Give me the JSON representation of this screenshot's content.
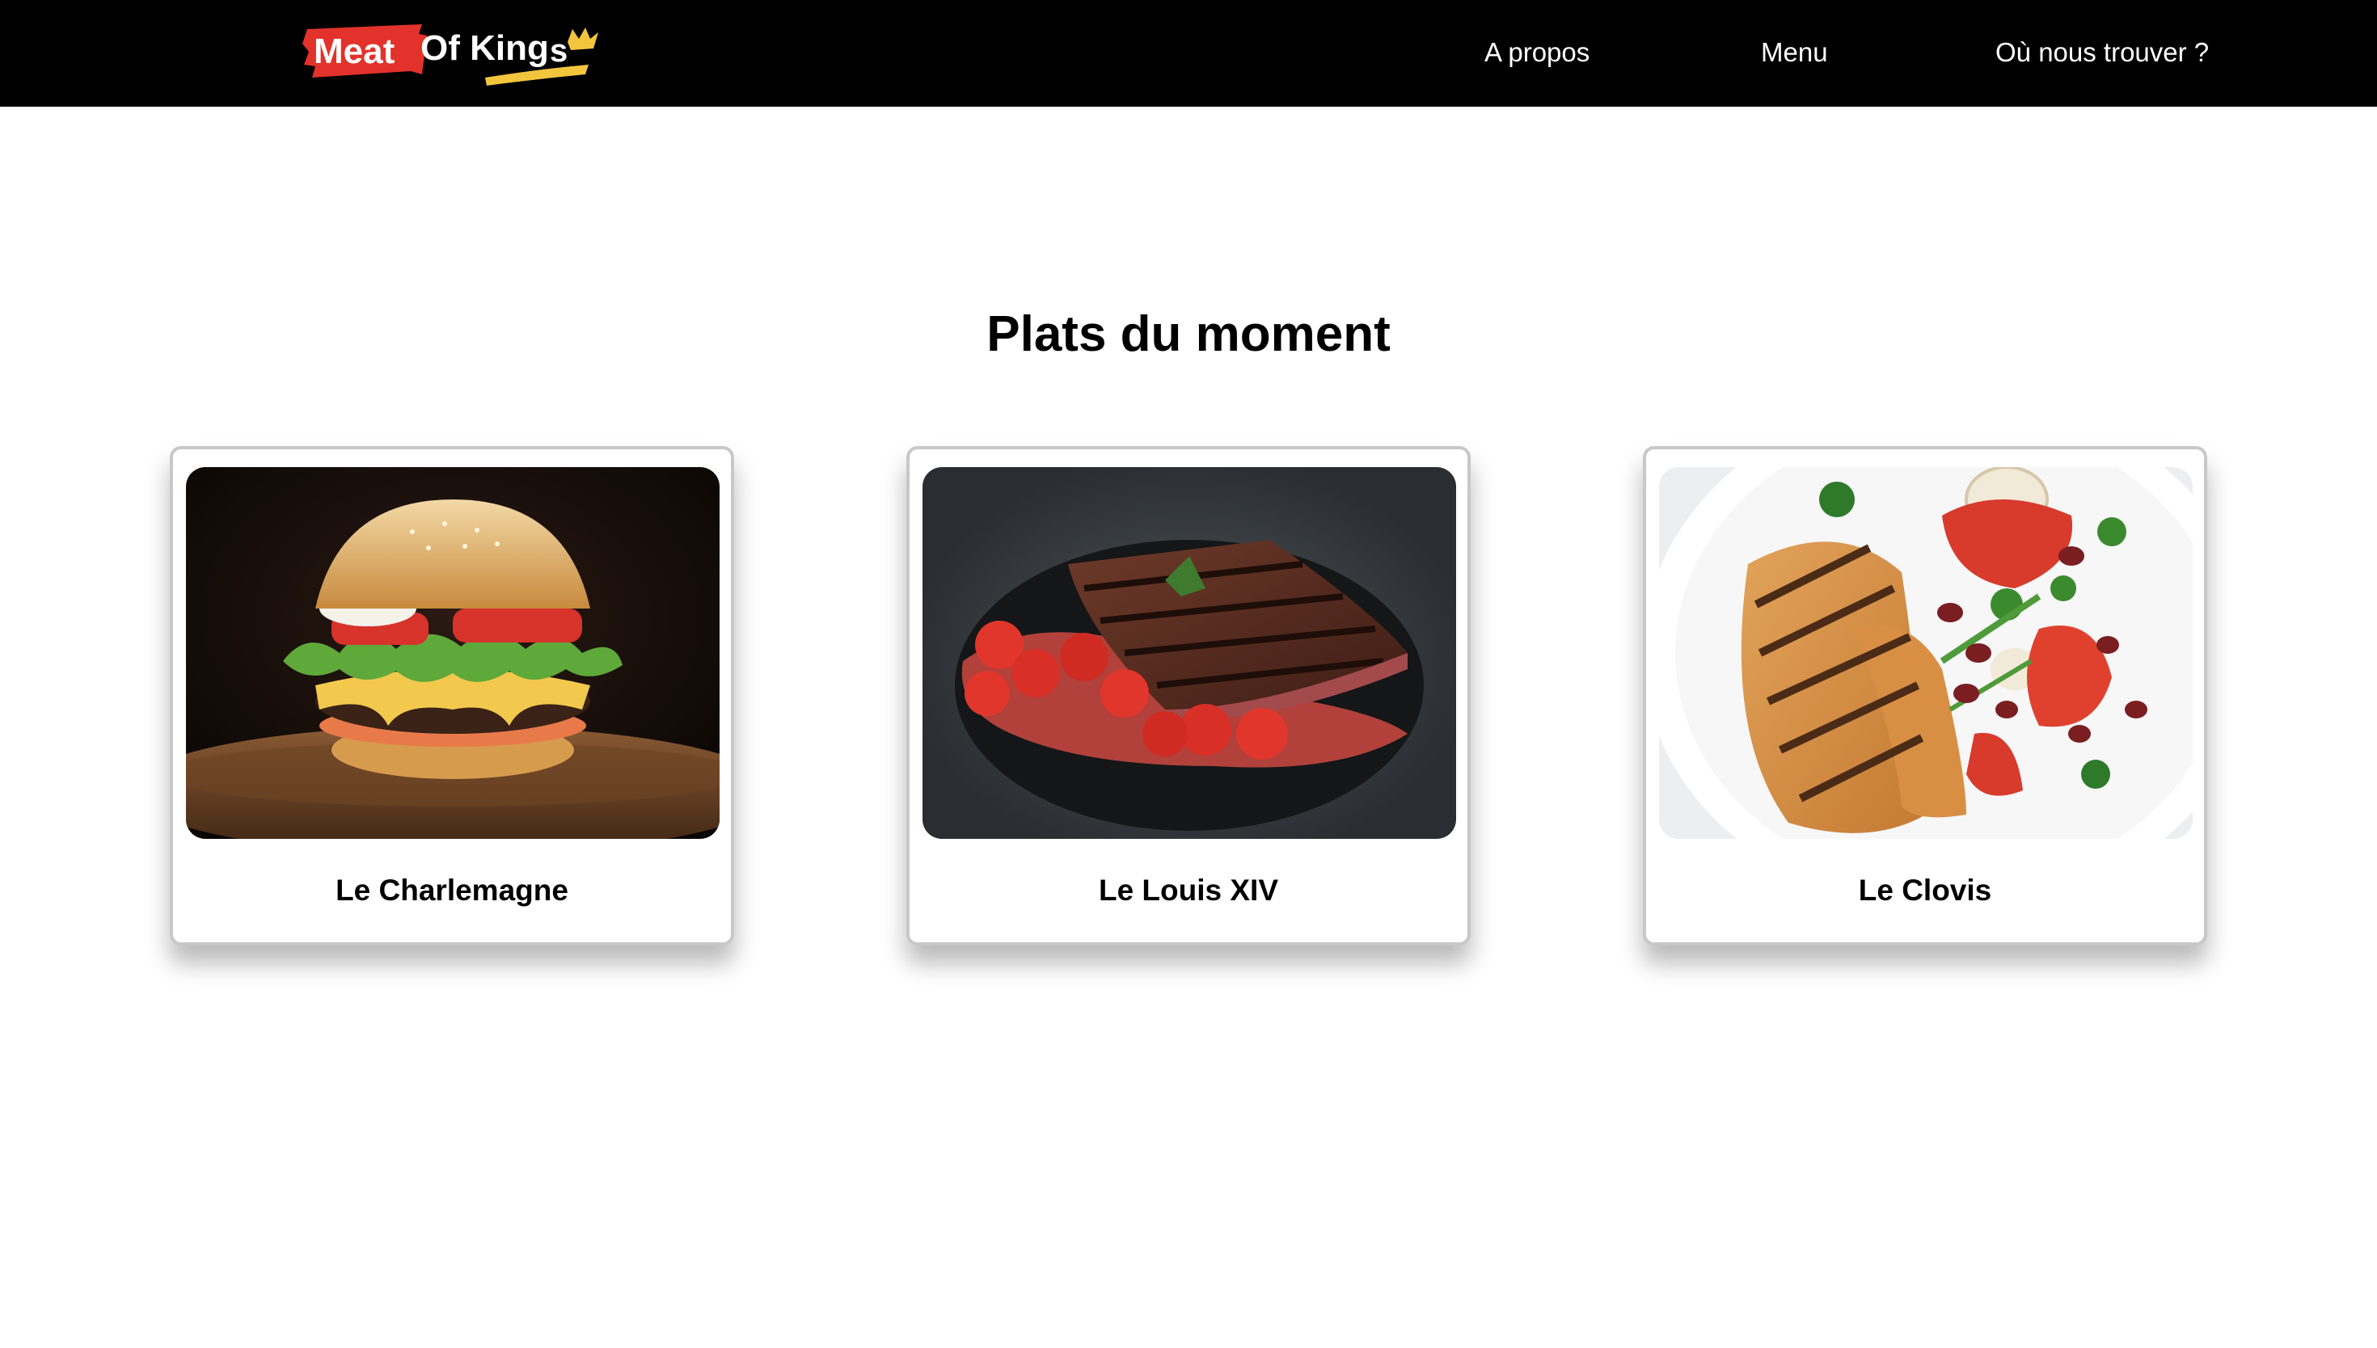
{
  "header": {
    "logo": {
      "text_part1": "Meat",
      "text_part2": "Of King",
      "text_part3": "s",
      "icon": "crown-icon"
    },
    "nav": [
      {
        "label": "A propos"
      },
      {
        "label": "Menu"
      },
      {
        "label": "Où nous trouver ?"
      }
    ]
  },
  "main": {
    "title": "Plats du moment",
    "dishes": [
      {
        "name": "Le Charlemagne",
        "image": "burger-image"
      },
      {
        "name": "Le Louis XIV",
        "image": "steak-image"
      },
      {
        "name": "Le Clovis",
        "image": "grilled-chicken-image"
      }
    ]
  },
  "colors": {
    "navbar": "#000000",
    "logo_red": "#e3322b",
    "logo_yellow": "#f2c53d",
    "text": "#000000",
    "card_border": "#c8c8c8"
  }
}
